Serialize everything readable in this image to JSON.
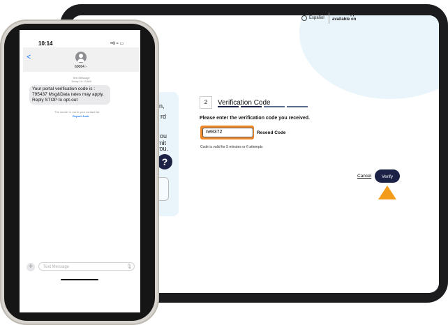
{
  "tablet": {
    "language_label": "Español",
    "healow_line1": "healow App",
    "healow_line2": "available on",
    "side_fragments": [
      "n,",
      "rd",
      "ou",
      "mit",
      "you."
    ],
    "help_symbol": "?",
    "step_number": "2",
    "step_title": "Verification Code",
    "prompt": "Please enter the verification code you received.",
    "code_value": "ne8372",
    "resend_label": "Resend Code",
    "valid_note": "Code is valid for 5 minutes or 6 attempts",
    "cancel_label": "Cancel",
    "verify_label": "Verify"
  },
  "phone": {
    "time": "10:14",
    "status_icons": "••ll ≈ ▭",
    "back_symbol": "<",
    "sender": "60064 ›",
    "meta_line1": "Text Message",
    "meta_line2": "Today 10:14 AM",
    "message": "Your portal verification code is : 795437 Msg&Data rates may apply. Reply STOP to opt-out",
    "notice": "The sender is not in your contact list.",
    "report_label": "Report Junk",
    "input_placeholder": "Text Message",
    "plus_symbol": "+",
    "mic_symbol": "🎙"
  },
  "colors": {
    "accent_orange": "#f39c1b",
    "navy": "#1b2245",
    "imessage_blue": "#1e7cf7",
    "light_blue_bg": "#e9f4fb"
  }
}
